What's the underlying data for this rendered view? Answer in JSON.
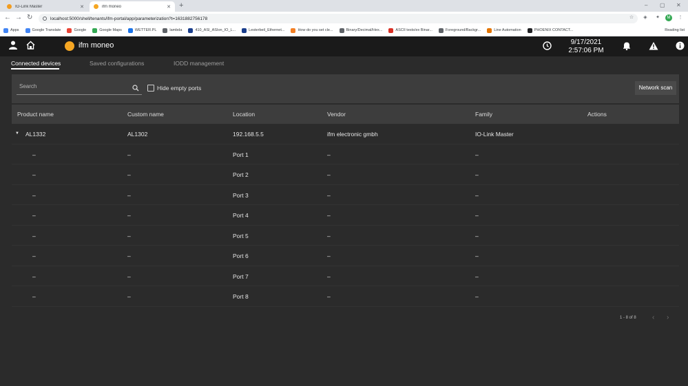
{
  "browser": {
    "tabs": [
      {
        "title": "IO-Link Master",
        "active": false,
        "favicon_color": "#f29c1f"
      },
      {
        "title": "ifm moneo",
        "active": true,
        "favicon_color": "#f5a623"
      }
    ],
    "new_tab": "+",
    "window_controls": {
      "minimize": "–",
      "maximize": "▢",
      "close": "✕"
    },
    "nav": {
      "back": "←",
      "forward": "→",
      "reload": "↻"
    },
    "url": "localhost:5000/shell/tenants/ifm-portal/app/parameterization?t=1631882756178",
    "bookmarks": [
      {
        "label": "Apps",
        "icon_color": "#4285f4"
      },
      {
        "label": "Google Translate",
        "icon_color": "#4285f4"
      },
      {
        "label": "Google",
        "icon_color": "#ea4335"
      },
      {
        "label": "Google Maps",
        "icon_color": "#34a853"
      },
      {
        "label": "WETTER.PL",
        "icon_color": "#1a73e8"
      },
      {
        "label": "lambda",
        "icon_color": "#5f6368"
      },
      {
        "label": "410_ASI_ASIon_IO_L...",
        "icon_color": "#1a3e8c"
      },
      {
        "label": "Lesterbeil_Ethernet...",
        "icon_color": "#1a3e8c"
      },
      {
        "label": "How do you set cle...",
        "icon_color": "#f48024"
      },
      {
        "label": "Binary/Decimal/Hex...",
        "icon_color": "#5f6368"
      },
      {
        "label": "ASCII tests/ex Binar...",
        "icon_color": "#d93025"
      },
      {
        "label": "Foreground/Backgr...",
        "icon_color": "#5f6368"
      },
      {
        "label": "Line Automation",
        "icon_color": "#e37400"
      },
      {
        "label": "PHOENIX CONTACT...",
        "icon_color": "#202124"
      }
    ],
    "reading_list": "Reading list",
    "profile_initial": "M"
  },
  "app": {
    "name": "ifm moneo",
    "date": "9/17/2021",
    "time": "2:57:06 PM",
    "accent": "#f5a623"
  },
  "tabs": [
    {
      "label": "Connected devices",
      "selected": true
    },
    {
      "label": "Saved configurations",
      "selected": false
    },
    {
      "label": "IODD management",
      "selected": false
    }
  ],
  "filter": {
    "search_placeholder": "Search",
    "hide_empty_label": "Hide empty ports",
    "network_scan_label": "Network scan"
  },
  "table": {
    "headers": [
      "Product name",
      "Custom name",
      "Location",
      "Vendor",
      "Family",
      "Actions"
    ],
    "device": {
      "product": "AL1332",
      "custom": "AL1302",
      "location": "192.168.5.5",
      "vendor": "ifm electronic gmbh",
      "family": "IO-Link Master"
    },
    "ports": [
      {
        "product": "–",
        "custom": "–",
        "location": "Port 1",
        "vendor": "–",
        "family": "–"
      },
      {
        "product": "–",
        "custom": "–",
        "location": "Port 2",
        "vendor": "–",
        "family": "–"
      },
      {
        "product": "–",
        "custom": "–",
        "location": "Port 3",
        "vendor": "–",
        "family": "–"
      },
      {
        "product": "–",
        "custom": "–",
        "location": "Port 4",
        "vendor": "–",
        "family": "–"
      },
      {
        "product": "–",
        "custom": "–",
        "location": "Port 5",
        "vendor": "–",
        "family": "–"
      },
      {
        "product": "–",
        "custom": "–",
        "location": "Port 6",
        "vendor": "–",
        "family": "–"
      },
      {
        "product": "–",
        "custom": "–",
        "location": "Port 7",
        "vendor": "–",
        "family": "–"
      },
      {
        "product": "–",
        "custom": "–",
        "location": "Port 8",
        "vendor": "–",
        "family": "–"
      }
    ]
  },
  "pagination": {
    "range": "1 - 8 of 8",
    "prev": "‹",
    "next": "›"
  }
}
